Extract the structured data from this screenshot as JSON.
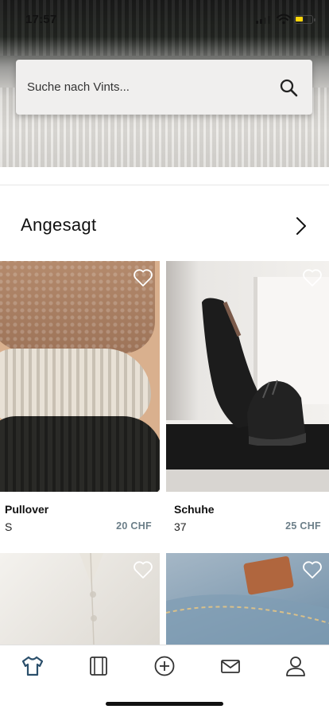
{
  "status_bar": {
    "time": "17:57"
  },
  "search": {
    "placeholder": "Suche nach Vints..."
  },
  "section": {
    "title": "Angesagt"
  },
  "products": [
    {
      "title": "Pullover",
      "size": "S",
      "price": "20 CHF"
    },
    {
      "title": "Schuhe",
      "size": "37",
      "price": "25 CHF"
    }
  ],
  "tabbar": {
    "tabs": [
      {
        "icon": "shirt-icon",
        "active": true
      },
      {
        "icon": "wardrobe-icon",
        "active": false
      },
      {
        "icon": "add-circle-icon",
        "active": false
      },
      {
        "icon": "mail-icon",
        "active": false
      },
      {
        "icon": "profile-icon",
        "active": false
      }
    ]
  },
  "colors": {
    "accent": "#2b4f6b",
    "price": "#6b7e88",
    "battery": "#ffd60a"
  }
}
